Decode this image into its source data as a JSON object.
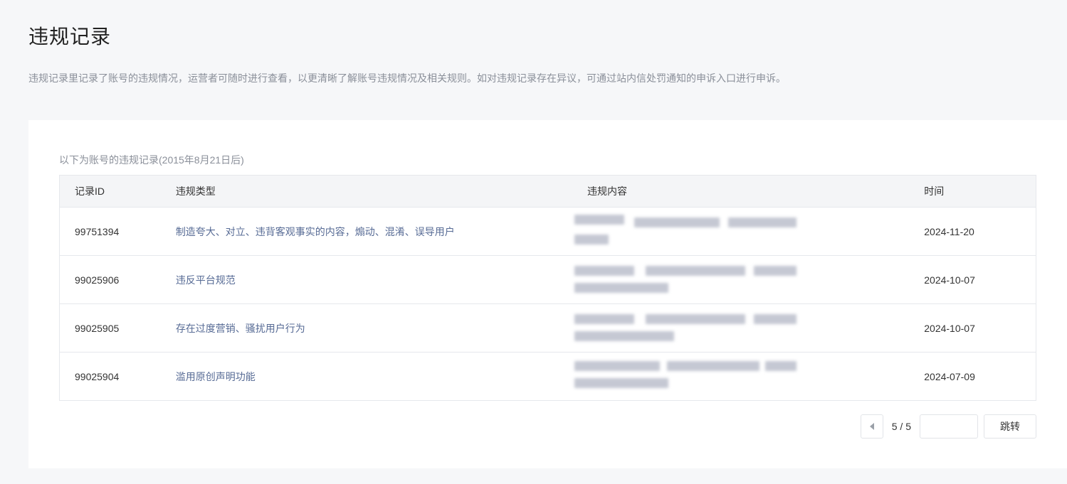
{
  "header": {
    "title": "违规记录",
    "description": "违规记录里记录了账号的违规情况，运营者可随时进行查看，以更清晰了解账号违规情况及相关规则。如对违规记录存在异议，可通过站内信处罚通知的申诉入口进行申诉。"
  },
  "records": {
    "intro": "以下为账号的违规记录(2015年8月21日后)",
    "columns": {
      "id": "记录ID",
      "type": "违规类型",
      "content": "违规内容",
      "time": "时间"
    },
    "rows": [
      {
        "id": "99751394",
        "type": "制造夸大、对立、违背客观事实的内容，煽动、混淆、误导用户",
        "time": "2024-11-20"
      },
      {
        "id": "99025906",
        "type": "违反平台规范",
        "time": "2024-10-07"
      },
      {
        "id": "99025905",
        "type": "存在过度营销、骚扰用户行为",
        "time": "2024-10-07"
      },
      {
        "id": "99025904",
        "type": "滥用原创声明功能",
        "time": "2024-07-09"
      }
    ]
  },
  "pagination": {
    "prev_icon": "caret-left-icon",
    "page_indicator": "5 / 5",
    "jump_input_value": "",
    "jump_label": "跳转"
  },
  "colors": {
    "background": "#f6f7f9",
    "link": "#576b95",
    "muted": "#8a8f99"
  }
}
